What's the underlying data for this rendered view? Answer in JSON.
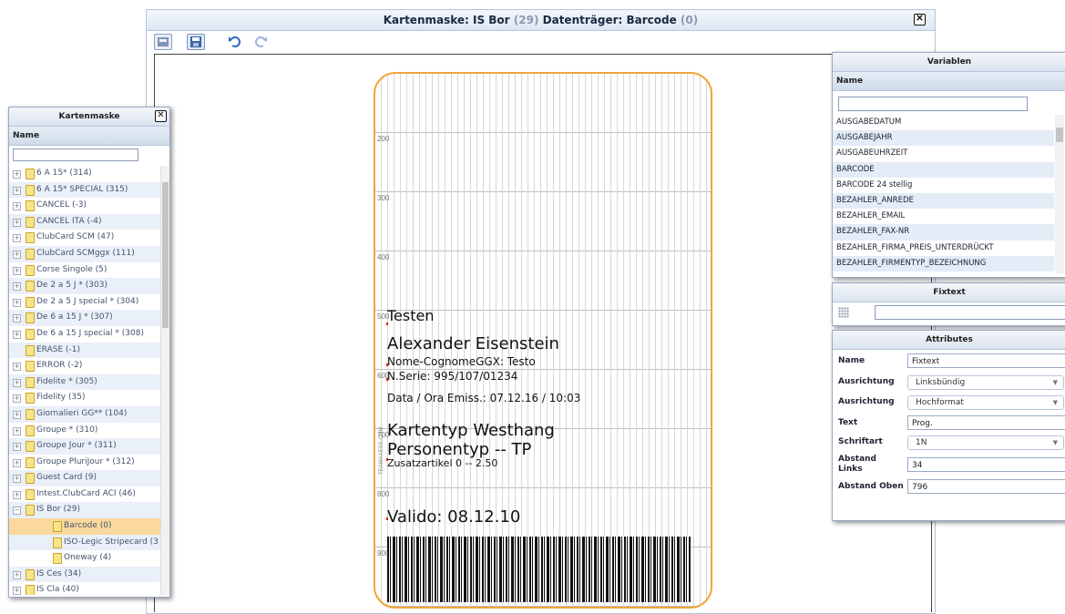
{
  "window": {
    "title_prefix": "Kartenmaske: IS Bor ",
    "title_count1": "(29)",
    "title_mid": " Datenträger: Barcode ",
    "title_count2": "(0)"
  },
  "toolbar": {
    "buttons": [
      "open-icon",
      "save-icon",
      "undo-icon",
      "redo-icon"
    ]
  },
  "card": {
    "rulers": [
      "200",
      "300",
      "400",
      "500",
      "600",
      "700",
      "800",
      "900"
    ],
    "testen": "Testen",
    "name": "Alexander Eisenstein",
    "nome": "Nome-CognomeGGX: Testo",
    "serie": "N.Serie: 995/107/01234",
    "data_ora": "Data / Ora Emiss.: 07.12.16 / 10:03",
    "kartentyp": "Kartentyp Westhang",
    "personentyp": "Personentyp -- TP",
    "zusatz": "Zusatzartikel 0 -- 2.50",
    "valido": "Valido: 08.12.10",
    "vertical": "TEAMAXESS.COM",
    "border_color": "#f3a43c"
  },
  "left_panel": {
    "title": "Kartenmaske",
    "column": "Name",
    "search_value": "",
    "items": [
      {
        "label": "6 A 15* ",
        "count": "(314)",
        "level": 0,
        "expander": "+"
      },
      {
        "label": "6 A 15* SPECIAL ",
        "count": "(315)",
        "level": 0,
        "expander": "+"
      },
      {
        "label": "CANCEL ",
        "count": "(-3)",
        "level": 0,
        "expander": "+"
      },
      {
        "label": "CANCEL ITA ",
        "count": "(-4)",
        "level": 0,
        "expander": "+"
      },
      {
        "label": "ClubCard SCM ",
        "count": "(47)",
        "level": 0,
        "expander": "+"
      },
      {
        "label": "ClubCard SCMggx ",
        "count": "(111)",
        "level": 0,
        "expander": "+"
      },
      {
        "label": "Corse Singole ",
        "count": "(5)",
        "level": 0,
        "expander": "+"
      },
      {
        "label": "De 2 a 5 J * ",
        "count": "(303)",
        "level": 0,
        "expander": "+"
      },
      {
        "label": "De 2 a 5 J special * ",
        "count": "(304)",
        "level": 0,
        "expander": "+"
      },
      {
        "label": "De 6 a 15 J * ",
        "count": "(307)",
        "level": 0,
        "expander": "+"
      },
      {
        "label": "De 6 a 15 J special * ",
        "count": "(308)",
        "level": 0,
        "expander": "+"
      },
      {
        "label": "ERASE ",
        "count": "(-1)",
        "level": 0,
        "expander": ""
      },
      {
        "label": "ERROR ",
        "count": "(-2)",
        "level": 0,
        "expander": "+"
      },
      {
        "label": "Fidelite * ",
        "count": "(305)",
        "level": 0,
        "expander": "+"
      },
      {
        "label": "Fidelity ",
        "count": "(35)",
        "level": 0,
        "expander": "+"
      },
      {
        "label": "Giornalieri GG** ",
        "count": "(104)",
        "level": 0,
        "expander": "+"
      },
      {
        "label": "Groupe * ",
        "count": "(310)",
        "level": 0,
        "expander": "+"
      },
      {
        "label": "Groupe Jour * ",
        "count": "(311)",
        "level": 0,
        "expander": "+"
      },
      {
        "label": "Groupe PluriJour * ",
        "count": "(312)",
        "level": 0,
        "expander": "+"
      },
      {
        "label": "Guest Card ",
        "count": "(9)",
        "level": 0,
        "expander": "+"
      },
      {
        "label": "Intest.ClubCard ACI ",
        "count": "(46)",
        "level": 0,
        "expander": "+"
      },
      {
        "label": "IS Bor ",
        "count": "(29)",
        "level": 0,
        "expander": "−"
      },
      {
        "label": "Barcode ",
        "count": "(0)",
        "level": 1,
        "expander": "",
        "selected": true
      },
      {
        "label": "ISO-Legic Stripecard ",
        "count": "(3",
        "level": 1,
        "expander": ""
      },
      {
        "label": "Oneway ",
        "count": "(4)",
        "level": 1,
        "expander": ""
      },
      {
        "label": "IS Ces ",
        "count": "(34)",
        "level": 0,
        "expander": "+"
      },
      {
        "label": "IS Cla ",
        "count": "(40)",
        "level": 0,
        "expander": "+"
      }
    ]
  },
  "variables_panel": {
    "title": "Variablen",
    "column": "Name",
    "search_value": "",
    "items": [
      "AUSGABEDATUM",
      "AUSGABEJAHR",
      "AUSGABEUHRZEIT",
      "BARCODE",
      "BARCODE 24 stellig",
      "BEZAHLER_ANREDE",
      "BEZAHLER_EMAIL",
      "BEZAHLER_FAX-NR",
      "BEZAHLER_FIRMA_PREIS_UNTERDRÜCKT",
      "BEZAHLER_FIRMENTYP_BEZEICHNUNG"
    ]
  },
  "fixtext_panel": {
    "title": "Fixtext",
    "value": ""
  },
  "attributes_panel": {
    "title": "Attributes",
    "name_label": "Name",
    "name_value": "Fixtext",
    "align1_label": "Ausrichtung",
    "align1_value": "Linksbündig",
    "align2_label": "Ausrichtung",
    "align2_value": "Hochformat",
    "text_label": "Text",
    "text_value": "Prog.",
    "font_label": "Schriftart",
    "font_value": "1N",
    "left_label": "Abstand Links",
    "left_value": "34",
    "top_label": "Abstand Oben",
    "top_value": "796"
  }
}
